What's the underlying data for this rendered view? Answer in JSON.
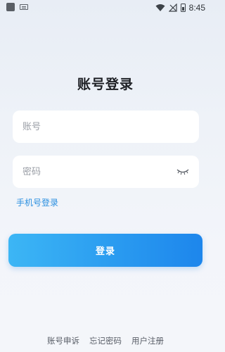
{
  "status_bar": {
    "time": "8:45",
    "icons": [
      "app-icon",
      "keyboard-icon",
      "wifi-icon",
      "no-signal-icon",
      "battery-icon"
    ]
  },
  "page": {
    "title": "账号登录"
  },
  "form": {
    "account_placeholder": "账号",
    "password_placeholder": "密码",
    "phone_login_link": "手机号登录",
    "login_button": "登录"
  },
  "footer": {
    "links": [
      "账号申诉",
      "忘记密码",
      "用户注册"
    ]
  },
  "colors": {
    "accent": "#2a9bf0",
    "link": "#2a8fe0",
    "title": "#1d1f24"
  }
}
